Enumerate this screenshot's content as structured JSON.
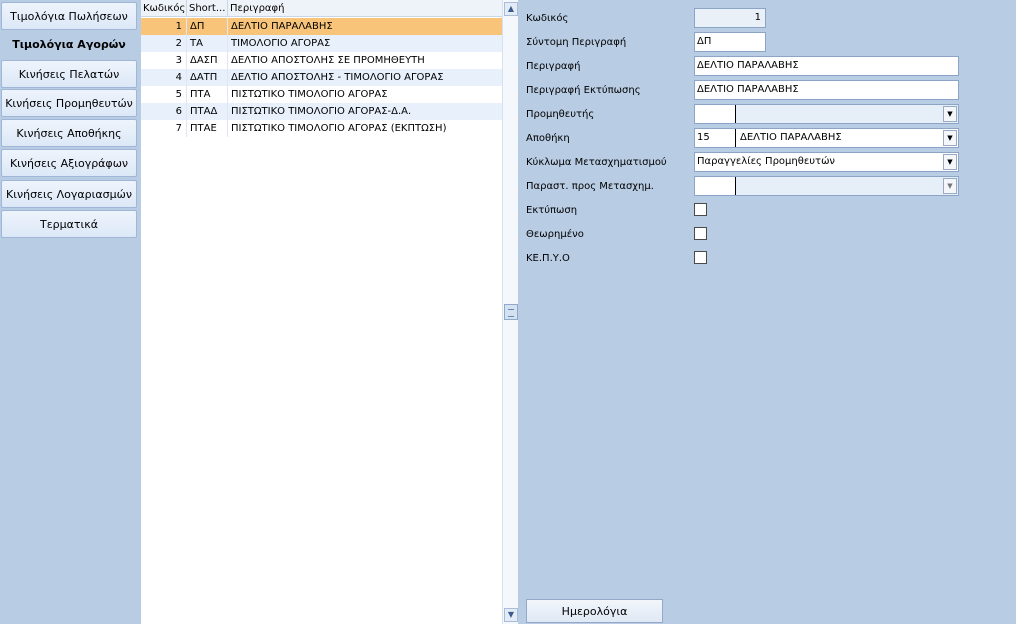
{
  "nav": {
    "items": [
      {
        "label": "Τιμολόγια Πωλήσεων",
        "active": false
      },
      {
        "label": "Τιμολόγια Αγορών",
        "active": true
      },
      {
        "label": "Κινήσεις Πελατών",
        "active": false
      },
      {
        "label": "Κινήσεις Προμηθευτών",
        "active": false
      },
      {
        "label": "Κινήσεις Αποθήκης",
        "active": false
      },
      {
        "label": "Κινήσεις Αξιογράφων",
        "active": false
      },
      {
        "label": "Κινήσεις Λογαριασμών",
        "active": false
      },
      {
        "label": "Τερματικά",
        "active": false
      }
    ]
  },
  "grid": {
    "headers": [
      "Κωδικός",
      "Short...",
      "Περιγραφή"
    ],
    "rows": [
      {
        "code": "1",
        "short": "ΔΠ",
        "desc": "ΔΕΛΤΙΟ ΠΑΡΑΛΑΒΗΣ",
        "selected": true
      },
      {
        "code": "2",
        "short": "ΤΑ",
        "desc": "ΤΙΜΟΛΟΓΙΟ ΑΓΟΡΑΣ"
      },
      {
        "code": "3",
        "short": "ΔΑΣΠ",
        "desc": "ΔΕΛΤΙΟ ΑΠΟΣΤΟΛΗΣ ΣΕ ΠΡΟΜΗΘΕΥΤΗ"
      },
      {
        "code": "4",
        "short": "ΔΑΤΠ",
        "desc": "ΔΕΛΤΙΟ ΑΠΟΣΤΟΛΗΣ - ΤΙΜΟΛΟΓΙΟ ΑΓΟΡΑΣ"
      },
      {
        "code": "5",
        "short": "ΠΤΑ",
        "desc": "ΠΙΣΤΩΤΙΚΟ ΤΙΜΟΛΟΓΙΟ ΑΓΟΡΑΣ"
      },
      {
        "code": "6",
        "short": "ΠΤΑΔ",
        "desc": "ΠΙΣΤΩΤΙΚΟ ΤΙΜΟΛΟΓΙΟ ΑΓΟΡΑΣ-Δ.Α."
      },
      {
        "code": "7",
        "short": "ΠΤΑΕ",
        "desc": "ΠΙΣΤΩΤΙΚΟ ΤΙΜΟΛΟΓΙΟ ΑΓΟΡΑΣ (ΕΚΠΤΩΣΗ)"
      }
    ]
  },
  "form": {
    "code_label": "Κωδικός",
    "code_value": "1",
    "short_label": "Σύντομη Περιγραφή",
    "short_value": "ΔΠ",
    "desc_label": "Περιγραφή",
    "desc_value": "ΔΕΛΤΙΟ ΠΑΡΑΛΑΒΗΣ",
    "print_desc_label": "Περιγραφή Εκτύπωσης",
    "print_desc_value": "ΔΕΛΤΙΟ ΠΑΡΑΛΑΒΗΣ",
    "supplier_label": "Προμηθευτής",
    "supplier_code": "",
    "supplier_name": "",
    "warehouse_label": "Αποθήκη",
    "warehouse_code": "15",
    "warehouse_name": "ΔΕΛΤΙΟ ΠΑΡΑΛΑΒΗΣ",
    "circuit_label": "Κύκλωμα Μετασχηματισμού",
    "circuit_value": "Παραγγελίες Προμηθευτών",
    "transform_doc_label": "Παραστ. προς Μετασχημ.",
    "transform_doc_code": "",
    "transform_doc_name": "",
    "print_label": "Εκτύπωση",
    "reviewed_label": "Θεωρημένο",
    "kepyo_label": "ΚΕ.Π.Υ.Ο",
    "journal_button": "Ημερολόγια"
  },
  "icons": {
    "dropdown": "chevron-down-icon",
    "scroll_up": "scroll-up-icon",
    "scroll_down": "scroll-down-icon"
  },
  "colors": {
    "panel_bg": "#b8cce4",
    "selected_row": "#f7c47a",
    "alt_row": "#e7f0fb"
  }
}
